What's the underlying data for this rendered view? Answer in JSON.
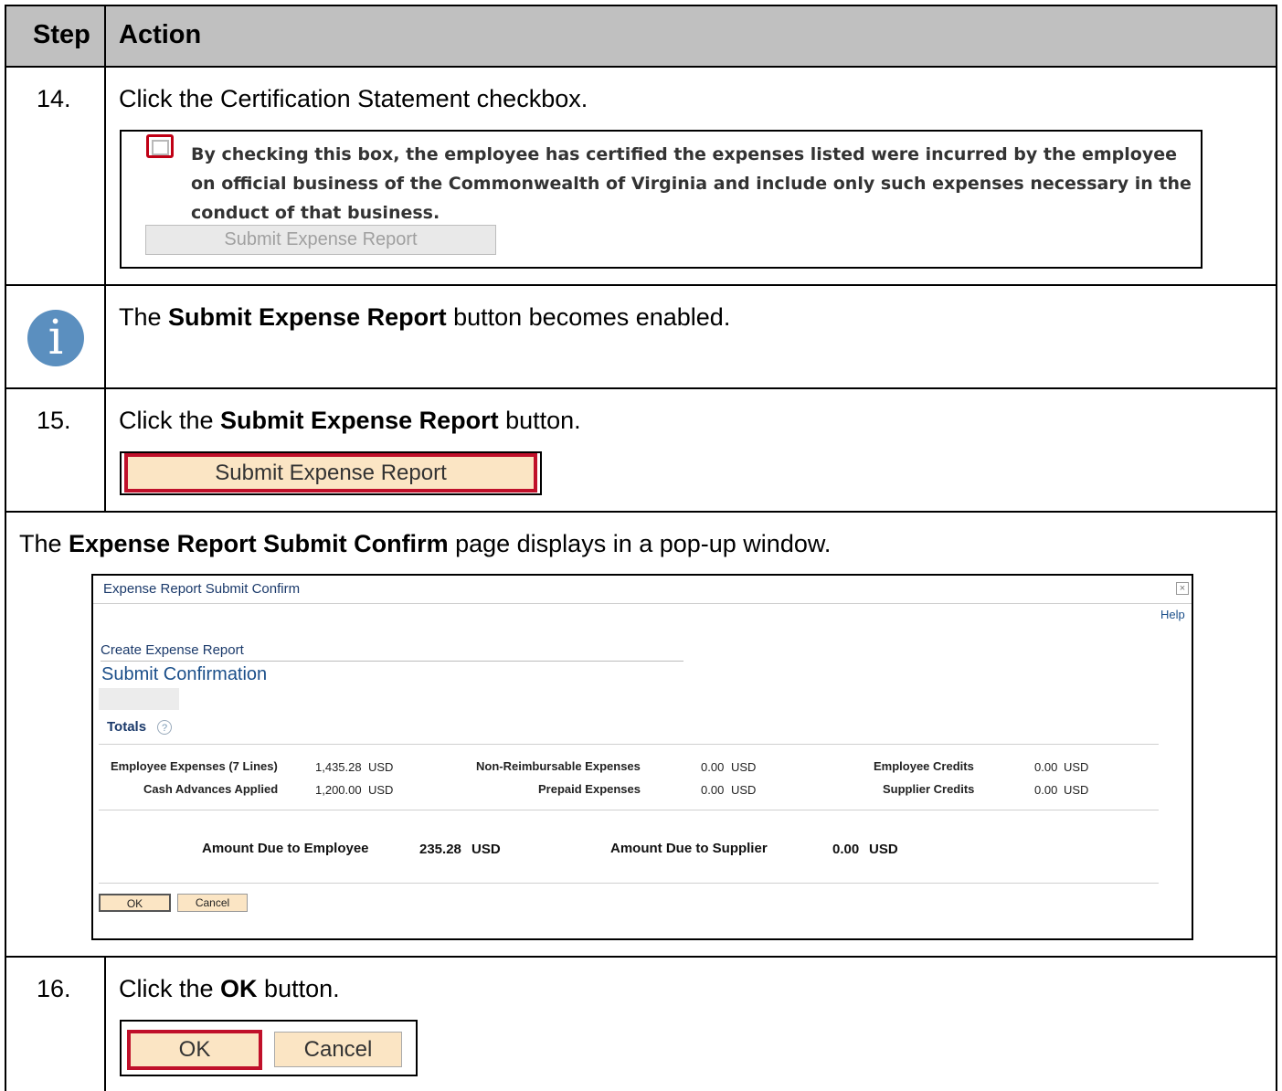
{
  "table": {
    "header": {
      "step": "Step",
      "action": "Action"
    },
    "row14": {
      "step": "14.",
      "instruction": "Click the Certification Statement checkbox.",
      "screenshot": {
        "certification_text": "By checking this box, the employee has certified the expenses listed were incurred by the employee on official business of the Commonwealth of Virginia and include only such expenses necessary in the conduct of that business.",
        "button_label": "Submit Expense Report"
      }
    },
    "info_row": {
      "icon": "info-icon",
      "prefix": "The ",
      "bold": "Submit Expense Report",
      "suffix": " button becomes enabled."
    },
    "row15": {
      "step": "15.",
      "prefix": "Click the ",
      "bold": "Submit Expense Report",
      "suffix": " button.",
      "button_label": "Submit Expense Report"
    },
    "popup_row": {
      "prefix": "The ",
      "bold": "Expense Report Submit Confirm",
      "suffix": " page displays in a pop-up window."
    },
    "row16": {
      "step": "16.",
      "prefix": "Click the ",
      "bold": "OK",
      "suffix": " button.",
      "ok_label": "OK",
      "cancel_label": "Cancel"
    }
  },
  "popup": {
    "title": "Expense Report Submit Confirm",
    "close": "×",
    "help": "Help",
    "breadcrumb": "Create Expense Report",
    "page_title": "Submit Confirmation",
    "totals_label": "Totals",
    "help_glyph": "?",
    "totals": {
      "employee_expenses_label": "Employee Expenses (7 Lines)",
      "employee_expenses_value": "1,435.28",
      "cash_advances_label": "Cash Advances Applied",
      "cash_advances_value": "1,200.00",
      "non_reimbursable_label": "Non-Reimbursable Expenses",
      "non_reimbursable_value": "0.00",
      "prepaid_label": "Prepaid Expenses",
      "prepaid_value": "0.00",
      "employee_credits_label": "Employee Credits",
      "employee_credits_value": "0.00",
      "supplier_credits_label": "Supplier Credits",
      "supplier_credits_value": "0.00",
      "currency": "USD"
    },
    "amount_due_employee_label": "Amount Due to Employee",
    "amount_due_employee_value": "235.28",
    "amount_due_supplier_label": "Amount Due to Supplier",
    "amount_due_supplier_value": "0.00",
    "ok_label": "OK",
    "cancel_label": "Cancel"
  },
  "colors": {
    "header_bg": "#c0c0c0",
    "highlight_red": "#c0102a",
    "button_bg": "#fbe5c4",
    "info_blue": "#5b8fbf",
    "link_blue": "#1b3a6b"
  }
}
